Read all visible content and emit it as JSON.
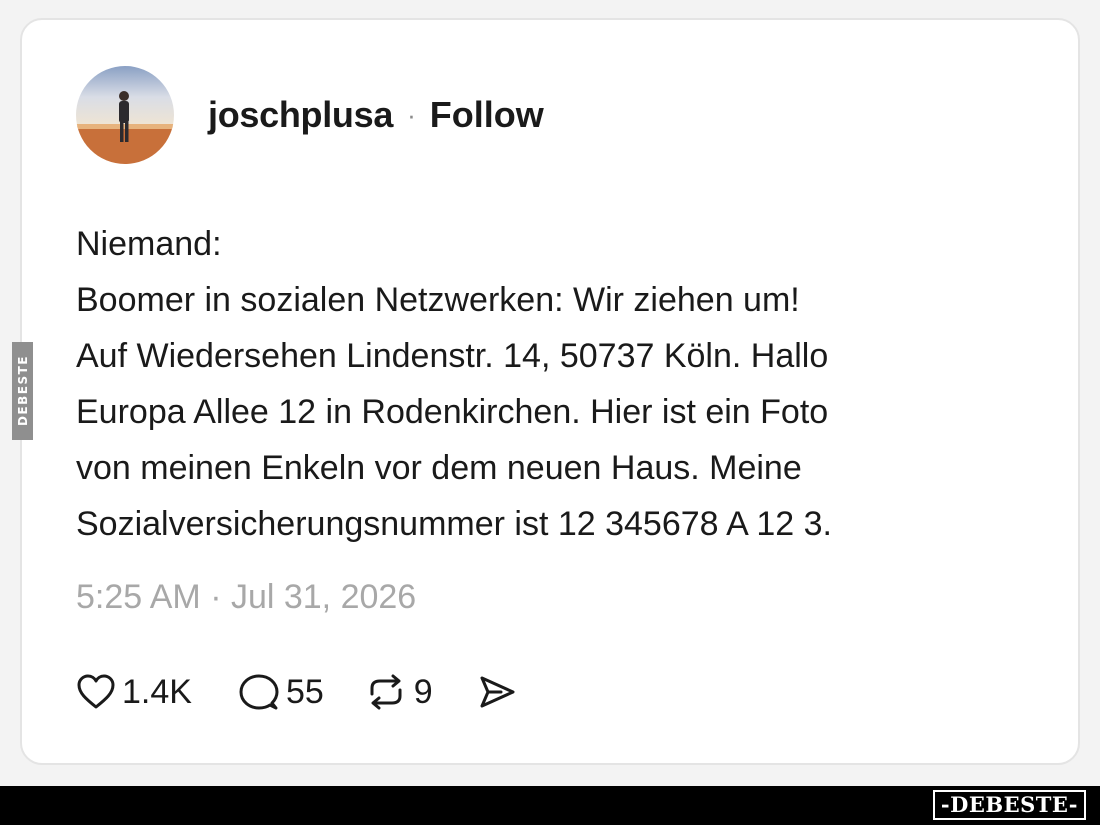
{
  "post": {
    "username": "joschplusa",
    "separator": "·",
    "follow_label": "Follow",
    "lines": [
      "Niemand:",
      "Boomer in sozialen Netzwerken: Wir ziehen um!",
      "Auf Wiedersehen Lindenstr. 14, 50737 Köln. Hallo",
      "Europa Allee 12 in Rodenkirchen. Hier ist ein Foto",
      "von meinen Enkeln vor dem neuen Haus. Meine",
      "Sozialversicherungsnummer ist 12 345678 A 12 3."
    ],
    "timestamp": "5:25 AM · Jul 31, 2026"
  },
  "actions": {
    "likes": "1.4K",
    "comments": "55",
    "reposts": "9",
    "icons": [
      "heart-icon",
      "comment-icon",
      "repost-icon",
      "share-icon"
    ]
  },
  "watermark": {
    "side_text": "DEBESTE",
    "brand_text": "-DEBESTE-"
  },
  "colors": {
    "background": "#f3f3f3",
    "card": "#ffffff",
    "text": "#1a1a1a",
    "muted": "#a8a8a8",
    "bar": "#000000"
  }
}
